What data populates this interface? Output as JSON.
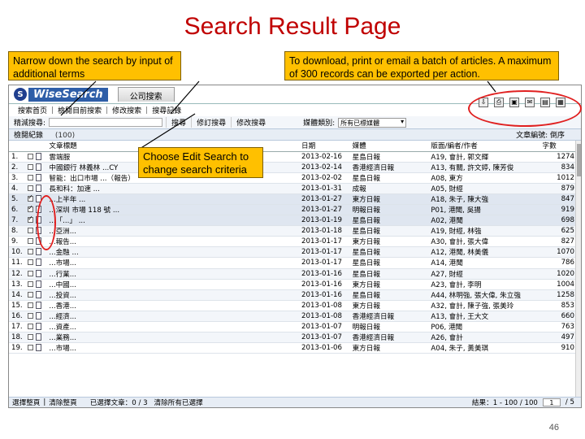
{
  "slide": {
    "title": "Search Result Page",
    "page_number": "46"
  },
  "callouts": {
    "left": "Narrow down the search by input of additional terms",
    "right": "To download, print or email a batch of articles. A maximum of 300 records can be exported per action.",
    "middle": "Choose Edit Search to change search criteria"
  },
  "app": {
    "logo_text": "WiseSearch",
    "company_tab": "公司搜索",
    "menu": [
      "搜索首页",
      "檢閱目前搜索",
      "修改搜索",
      "搜尋記錄"
    ],
    "toolbar": {
      "label": "精減搜尋:",
      "buttons": [
        "搜尋",
        "修訂搜尋",
        "修改搜尋"
      ],
      "select_label": "媒體類別:",
      "select_value": "所有已標媒體"
    },
    "action_icons": [
      "download-icon",
      "print-icon",
      "save-icon",
      "email-icon",
      "folder-icon",
      "export-icon"
    ],
    "result_bar": {
      "label": "檢閱紀錄",
      "count": "(100)",
      "sort_label": "文章編號: 倒序"
    },
    "columns": [
      "",
      "",
      "文章標題",
      "日期",
      "媒體",
      "版面/編者/作者",
      "字數"
    ],
    "rows": [
      {
        "n": "1.",
        "title": "雲端服",
        "date": "2013-02-16",
        "media": "星島日報",
        "author": "A19, 會計, 郭文輝",
        "words": "1274",
        "checked": false
      },
      {
        "n": "2.",
        "title": "中國銀行 林義林 ...CY",
        "date": "2013-02-14",
        "media": "香港經濟日報",
        "author": "A13, 有關, 許文婷, 陳芳俊",
        "words": "834",
        "checked": false
      },
      {
        "n": "3.",
        "title": "智能：出口市場 ...（報告）",
        "date": "2013-02-02",
        "media": "星島日報",
        "author": "A08, 東方",
        "words": "1012",
        "checked": false
      },
      {
        "n": "4.",
        "title": "長和科：加速 ...",
        "date": "2013-01-31",
        "media": "成報",
        "author": "A05, 財經",
        "words": "879",
        "checked": false
      },
      {
        "n": "5.",
        "title": "...上半年 ...",
        "date": "2013-01-27",
        "media": "東方日報",
        "author": "A18, 朱子, 陳大強",
        "words": "847",
        "checked": true
      },
      {
        "n": "6.",
        "title": "...深圳 市場 118 號 ...",
        "date": "2013-01-27",
        "media": "明報日報",
        "author": "P01, 港聞, 吳揚",
        "words": "919",
        "checked": true
      },
      {
        "n": "7.",
        "title": "...「...」 ...",
        "date": "2013-01-19",
        "media": "星島日報",
        "author": "A02, 港聞",
        "words": "698",
        "checked": true
      },
      {
        "n": "8.",
        "title": "...亞洲...",
        "date": "2013-01-18",
        "media": "星島日報",
        "author": "A19, 財經, 林強",
        "words": "625",
        "checked": false
      },
      {
        "n": "9.",
        "title": "...報告...",
        "date": "2013-01-17",
        "media": "東方日報",
        "author": "A30, 會計, 張大偉",
        "words": "827",
        "checked": false
      },
      {
        "n": "10.",
        "title": "...金融 ...",
        "date": "2013-01-17",
        "media": "星島日報",
        "author": "A12, 港聞, 林美儀",
        "words": "1070",
        "checked": false
      },
      {
        "n": "11.",
        "title": "...市場...",
        "date": "2013-01-17",
        "media": "星島日報",
        "author": "A14, 港聞",
        "words": "786",
        "checked": false
      },
      {
        "n": "12.",
        "title": "...行業...",
        "date": "2013-01-16",
        "media": "星島日報",
        "author": "A27, 財經",
        "words": "1020",
        "checked": false
      },
      {
        "n": "13.",
        "title": "...中國...",
        "date": "2013-01-16",
        "media": "東方日報",
        "author": "A23, 會計, 李明",
        "words": "1004",
        "checked": false
      },
      {
        "n": "14.",
        "title": "...投資...",
        "date": "2013-01-16",
        "media": "星島日報",
        "author": "A44, 林明強, 張大偉, 朱立強",
        "words": "1258",
        "checked": false
      },
      {
        "n": "15.",
        "title": "...香港...",
        "date": "2013-01-08",
        "media": "東方日報",
        "author": "A32, 會計, 陳子強, 張美玲",
        "words": "853",
        "checked": false
      },
      {
        "n": "16.",
        "title": "...經濟...",
        "date": "2013-01-08",
        "media": "香港經濟日報",
        "author": "A13, 會計, 王大文",
        "words": "660",
        "checked": false
      },
      {
        "n": "17.",
        "title": "...資產...",
        "date": "2013-01-07",
        "media": "明報日報",
        "author": "P06, 港聞",
        "words": "763",
        "checked": false
      },
      {
        "n": "18.",
        "title": "...業務...",
        "date": "2013-01-07",
        "media": "香港經濟日報",
        "author": "A26, 會計",
        "words": "497",
        "checked": false
      },
      {
        "n": "19.",
        "title": "...市場...",
        "date": "2013-01-06",
        "media": "東方日報",
        "author": "A04, 朱子, 黃美琪",
        "words": "910",
        "checked": false
      }
    ],
    "footer": {
      "select_all": "選擇整頁",
      "deselect": "清除整頁",
      "selected": "已選擇文章：0 / 3",
      "clear_link": "清除所有已選擇",
      "range": "結果：1 - 100 / 100",
      "page_value": "1",
      "page_total": "/ 5"
    }
  }
}
